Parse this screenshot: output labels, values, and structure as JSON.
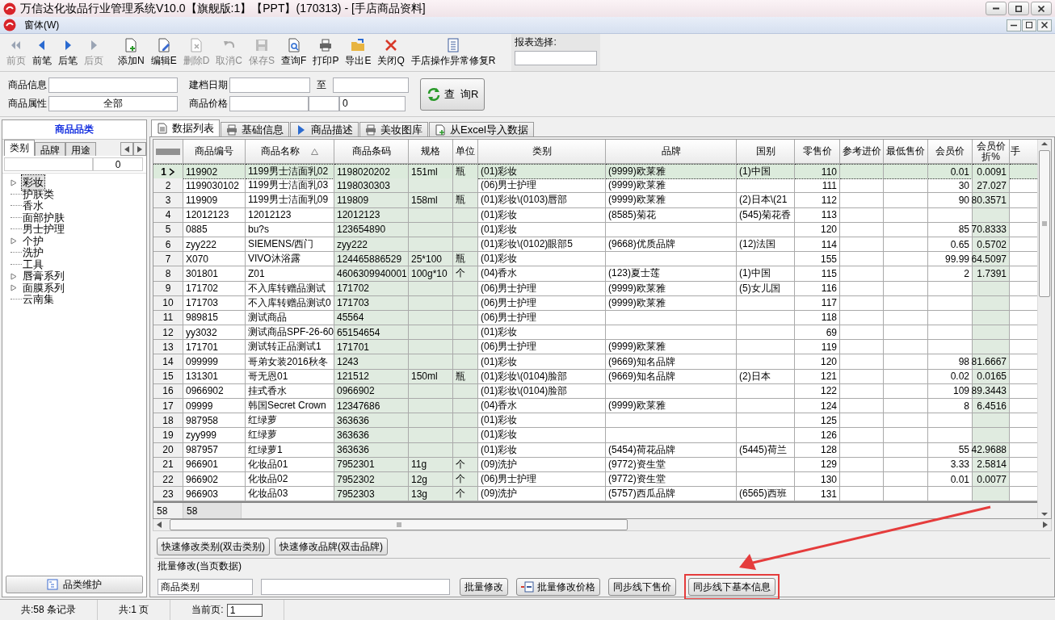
{
  "window": {
    "title": "万信达化妆品行业管理系统V10.0【旗舰版:1】【PPT】(170313) - [手店商品资料]"
  },
  "menu": [
    {
      "label": "窗体(W)"
    }
  ],
  "toolbar": [
    {
      "label": "前页",
      "disabled": true
    },
    {
      "label": "前笔",
      "disabled": false
    },
    {
      "label": "后笔",
      "disabled": false
    },
    {
      "label": "后页",
      "disabled": true
    },
    {
      "label": "添加N",
      "disabled": false
    },
    {
      "label": "编辑E",
      "disabled": false
    },
    {
      "label": "删除D",
      "disabled": true
    },
    {
      "label": "取消C",
      "disabled": true
    },
    {
      "label": "保存S",
      "disabled": true
    },
    {
      "label": "查询F",
      "disabled": false
    },
    {
      "label": "打印P",
      "disabled": false
    },
    {
      "label": "导出E",
      "disabled": false
    },
    {
      "label": "关闭Q",
      "disabled": false
    },
    {
      "label": "手店操作异常修复R",
      "disabled": false
    }
  ],
  "report_select": {
    "label": "报表选择:"
  },
  "filters": {
    "product_info": "商品信息",
    "product_attr": "商品属性",
    "product_attr_value": "全部",
    "date_label": "建档日期",
    "date_to": "至",
    "price_label": "商品价格",
    "price_value": "0",
    "query_button": "查  询R"
  },
  "sidebar": {
    "title": "商品品类",
    "tabs": [
      {
        "label": "类别",
        "selected": true
      },
      {
        "label": "品牌",
        "selected": false
      },
      {
        "label": "用途",
        "selected": false
      }
    ],
    "count": "0",
    "tree": [
      {
        "label": "彩妆",
        "expandable": true,
        "selected": true
      },
      {
        "label": "护肤类",
        "expandable": false,
        "selected": false
      },
      {
        "label": "香水",
        "expandable": false,
        "selected": false
      },
      {
        "label": "面部护肤",
        "expandable": false,
        "selected": false
      },
      {
        "label": "男士护理",
        "expandable": false,
        "selected": false
      },
      {
        "label": "个护",
        "expandable": true,
        "selected": false
      },
      {
        "label": "洗护",
        "expandable": false,
        "selected": false
      },
      {
        "label": "工具",
        "expandable": false,
        "selected": false
      },
      {
        "label": "唇膏系列",
        "expandable": true,
        "selected": false
      },
      {
        "label": "面膜系列",
        "expandable": true,
        "selected": false
      },
      {
        "label": "云南集",
        "expandable": false,
        "selected": false
      }
    ],
    "maintain_button": "品类维护"
  },
  "tabs": [
    {
      "label": "数据列表",
      "selected": true
    },
    {
      "label": "基础信息",
      "selected": false
    },
    {
      "label": "商品描述",
      "selected": false
    },
    {
      "label": "美妆图库",
      "selected": false
    },
    {
      "label": "从Excel导入数据",
      "selected": false
    }
  ],
  "table": {
    "columns": [
      {
        "label": "商品编号",
        "kind": "text",
        "shaded": false,
        "sorted": false
      },
      {
        "label": "商品名称",
        "kind": "text",
        "shaded": false,
        "sorted": true
      },
      {
        "label": "商品条码",
        "kind": "text",
        "shaded": true,
        "sorted": false
      },
      {
        "label": "规格",
        "kind": "text",
        "shaded": true,
        "sorted": false
      },
      {
        "label": "单位",
        "kind": "text",
        "shaded": true,
        "sorted": false
      },
      {
        "label": "类别",
        "kind": "text",
        "shaded": false,
        "sorted": false
      },
      {
        "label": "品牌",
        "kind": "text",
        "shaded": false,
        "sorted": false
      },
      {
        "label": "国别",
        "kind": "text",
        "shaded": false,
        "sorted": false
      },
      {
        "label": "零售价",
        "kind": "number",
        "shaded": false,
        "sorted": false
      },
      {
        "label": "参考进价",
        "kind": "number",
        "shaded": false,
        "sorted": false
      },
      {
        "label": "最低售价",
        "kind": "number",
        "shaded": false,
        "sorted": false
      },
      {
        "label": "会员价",
        "kind": "number",
        "shaded": false,
        "sorted": false
      },
      {
        "label": "会员价折%",
        "kind": "number",
        "shaded": true,
        "sorted": false
      },
      {
        "label": "手",
        "kind": "text",
        "shaded": false,
        "sorted": false
      }
    ],
    "rows": [
      {
        "number": "1",
        "selected": true,
        "cells": [
          "119902",
          "1199男士洁面乳02",
          "1198020202",
          "151ml",
          "瓶",
          "(01)彩妆",
          "(9999)欧莱雅",
          "(1)中国",
          "110",
          null,
          null,
          "0.01",
          "0.0091",
          null
        ]
      },
      {
        "number": "2",
        "selected": false,
        "cells": [
          "1199030102",
          "1199男士洁面乳03",
          "1198030303",
          null,
          null,
          "(06)男士护理",
          "(9999)欧莱雅",
          null,
          "111",
          null,
          null,
          "30",
          "27.027",
          null
        ]
      },
      {
        "number": "3",
        "selected": false,
        "cells": [
          "119909",
          "1199男士洁面乳09",
          "119809",
          "158ml",
          "瓶",
          "(01)彩妆\\(0103)唇部",
          "(9999)欧莱雅",
          "(2)日本\\(21",
          "112",
          null,
          null,
          "90",
          "80.3571",
          null
        ]
      },
      {
        "number": "4",
        "selected": false,
        "cells": [
          "12012123",
          "12012123",
          "12012123",
          null,
          null,
          "(01)彩妆",
          "(8585)菊花",
          "(545)菊花香",
          "113",
          null,
          null,
          null,
          null,
          null
        ]
      },
      {
        "number": "5",
        "selected": false,
        "cells": [
          "0885",
          "bu?s",
          "123654890",
          null,
          null,
          "(01)彩妆",
          null,
          null,
          "120",
          null,
          null,
          "85",
          "70.8333",
          null
        ]
      },
      {
        "number": "6",
        "selected": false,
        "cells": [
          "zyy222",
          "SIEMENS/西门",
          "zyy222",
          null,
          null,
          "(01)彩妆\\(0102)眼部5",
          "(9668)优质品牌",
          "(12)法国",
          "114",
          null,
          null,
          "0.65",
          "0.5702",
          null
        ]
      },
      {
        "number": "7",
        "selected": false,
        "cells": [
          "X070",
          "VIVO沐浴露",
          "124465886529",
          "25*100",
          "瓶",
          "(01)彩妆",
          null,
          null,
          "155",
          null,
          null,
          "99.99",
          "64.5097",
          null
        ]
      },
      {
        "number": "8",
        "selected": false,
        "cells": [
          "301801",
          "Z01",
          "4606309940001",
          "100g*10",
          "个",
          "(04)香水",
          "(123)夏士莲",
          "(1)中国",
          "115",
          null,
          null,
          "2",
          "1.7391",
          null
        ]
      },
      {
        "number": "9",
        "selected": false,
        "cells": [
          "171702",
          "不入库转赠品测试",
          "171702",
          null,
          null,
          "(06)男士护理",
          "(9999)欧莱雅",
          "(5)女儿国",
          "116",
          null,
          null,
          null,
          null,
          null
        ]
      },
      {
        "number": "10",
        "selected": false,
        "cells": [
          "171703",
          "不入库转赠品测试0",
          "171703",
          null,
          null,
          "(06)男士护理",
          "(9999)欧莱雅",
          null,
          "117",
          null,
          null,
          null,
          null,
          null
        ]
      },
      {
        "number": "11",
        "selected": false,
        "cells": [
          "989815",
          "测试商品",
          "45564",
          null,
          null,
          "(06)男士护理",
          null,
          null,
          "118",
          null,
          null,
          null,
          null,
          null
        ]
      },
      {
        "number": "12",
        "selected": false,
        "cells": [
          "yy3032",
          "测试商品SPF-26-60",
          "65154654",
          null,
          null,
          "(01)彩妆",
          null,
          null,
          "69",
          null,
          null,
          null,
          null,
          null
        ]
      },
      {
        "number": "13",
        "selected": false,
        "cells": [
          "171701",
          "测试转正品测试1",
          "171701",
          null,
          null,
          "(06)男士护理",
          "(9999)欧莱雅",
          null,
          "119",
          null,
          null,
          null,
          null,
          null
        ]
      },
      {
        "number": "14",
        "selected": false,
        "cells": [
          "099999",
          "哥弟女装2016秋冬",
          "1243",
          null,
          null,
          "(01)彩妆",
          "(9669)知名品牌",
          null,
          "120",
          null,
          null,
          "98",
          "81.6667",
          null
        ]
      },
      {
        "number": "15",
        "selected": false,
        "cells": [
          "131301",
          "哥无恩01",
          "121512",
          "150ml",
          "瓶",
          "(01)彩妆\\(0104)脸部",
          "(9669)知名品牌",
          "(2)日本",
          "121",
          null,
          null,
          "0.02",
          "0.0165",
          null
        ]
      },
      {
        "number": "16",
        "selected": false,
        "cells": [
          "0966902",
          "挂式香水",
          "0966902",
          null,
          null,
          "(01)彩妆\\(0104)脸部",
          null,
          null,
          "122",
          null,
          null,
          "109",
          "89.3443",
          null
        ]
      },
      {
        "number": "17",
        "selected": false,
        "cells": [
          "09999",
          "韩国Secret Crown",
          "12347686",
          null,
          null,
          "(04)香水",
          "(9999)欧莱雅",
          null,
          "124",
          null,
          null,
          "8",
          "6.4516",
          null
        ]
      },
      {
        "number": "18",
        "selected": false,
        "cells": [
          "987958",
          "红绿萝",
          "363636",
          null,
          null,
          "(01)彩妆",
          null,
          null,
          "125",
          null,
          null,
          null,
          null,
          null
        ]
      },
      {
        "number": "19",
        "selected": false,
        "cells": [
          "zyy999",
          "红绿萝",
          "363636",
          null,
          null,
          "(01)彩妆",
          null,
          null,
          "126",
          null,
          null,
          null,
          null,
          null
        ]
      },
      {
        "number": "20",
        "selected": false,
        "cells": [
          "987957",
          "红绿萝1",
          "363636",
          null,
          null,
          "(01)彩妆",
          "(5454)荷花品牌",
          "(5445)荷兰",
          "128",
          null,
          null,
          "55",
          "42.9688",
          null
        ]
      },
      {
        "number": "21",
        "selected": false,
        "cells": [
          "966901",
          "化妆品01",
          "7952301",
          "11g",
          "个",
          "(09)洗护",
          "(9772)资生堂",
          null,
          "129",
          null,
          null,
          "3.33",
          "2.5814",
          null
        ]
      },
      {
        "number": "22",
        "selected": false,
        "cells": [
          "966902",
          "化妆品02",
          "7952302",
          "12g",
          "个",
          "(06)男士护理",
          "(9772)资生堂",
          null,
          "130",
          null,
          null,
          "0.01",
          "0.0077",
          null
        ]
      },
      {
        "number": "23",
        "selected": false,
        "cells": [
          "966903",
          "化妆品03",
          "7952303",
          "13g",
          "个",
          "(09)洗护",
          "(5757)西瓜品牌",
          "(6565)西班",
          "131",
          null,
          null,
          null,
          null,
          null
        ]
      }
    ],
    "footer": {
      "count": "58",
      "value": "58"
    }
  },
  "quick_buttons": [
    "快速修改类别(双击类别)",
    "快速修改品牌(双击品牌)"
  ],
  "batch": {
    "title": "批量修改(当页数据)",
    "field_value": "商品类别",
    "buttons": [
      {
        "label": "批量修改",
        "highlighted": false
      },
      {
        "label": "批量修改价格",
        "highlighted": false
      },
      {
        "label": "同步线下售价",
        "highlighted": false
      },
      {
        "label": "同步线下基本信息",
        "highlighted": true
      }
    ]
  },
  "status_bar": {
    "records": "共:58 条记录",
    "pages": "共:1 页",
    "current_label": "当前页:",
    "current_value": "1"
  }
}
